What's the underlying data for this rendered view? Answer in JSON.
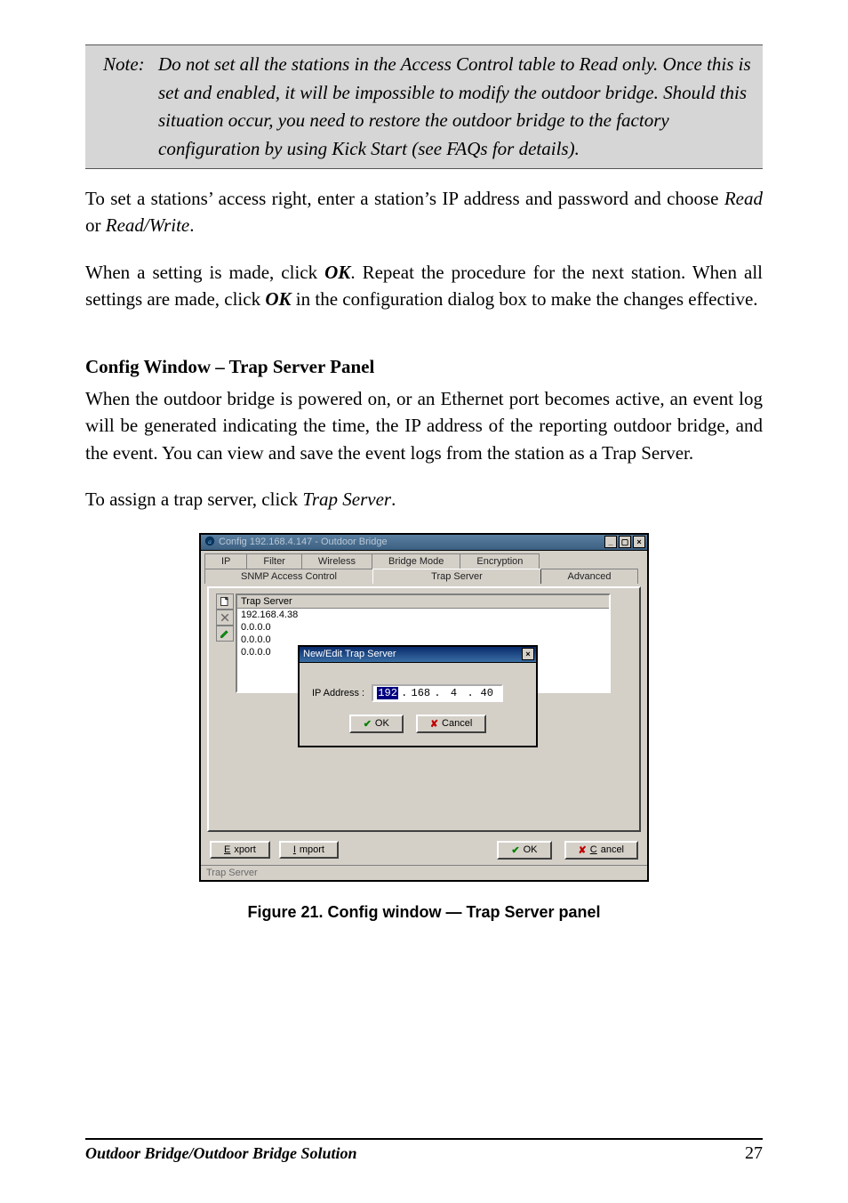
{
  "note": {
    "label": "Note:",
    "text": "Do not set all the stations in the Access Control table to Read only. Once this is set and enabled, it will be impossible to modify the outdoor bridge. Should this situation occur, you need to restore the outdoor bridge to the factory configuration by using Kick Start (see FAQs for details)."
  },
  "para1_a": "To set a stations’ access right, enter a station’s IP address and password and choose ",
  "para1_b": "Read",
  "para1_c": " or ",
  "para1_d": "Read/Write",
  "para1_e": ".",
  "para2_a": "When a setting is made, click ",
  "para2_b": "OK",
  "para2_c": ". Repeat the procedure for the next station. When all settings are made, click ",
  "para2_d": "OK",
  "para2_e": " in the configuration dialog box to make the changes effective.",
  "heading": "Config Window – Trap Server Panel",
  "para3": "When the outdoor bridge is powered on, or an Ethernet port becomes active, an event log will be generated indicating the time, the IP address of the reporting outdoor bridge, and the event. You can view and save the event logs from the station as a Trap Server.",
  "para4_a": "To assign a trap server, click ",
  "para4_b": "Trap Server",
  "para4_c": ".",
  "figcap": "Figure 21.  Config window — Trap Server panel",
  "footer": {
    "title": "Outdoor Bridge/Outdoor Bridge Solution",
    "page": "27"
  },
  "win": {
    "title": "Config 192.168.4.147 - Outdoor Bridge",
    "tabs_row1": [
      "IP",
      "Filter",
      "Wireless",
      "Bridge Mode",
      "Encryption"
    ],
    "tabs_row2": [
      "SNMP Access Control",
      "Trap Server",
      "Advanced"
    ],
    "active_tab": "Trap Server",
    "list_header": "Trap Server",
    "list_items": [
      "192.168.4.38",
      "0.0.0.0",
      "0.0.0.0",
      "0.0.0.0"
    ],
    "buttons": {
      "export": "Export",
      "import": "Import",
      "ok": "OK",
      "cancel": "Cancel"
    },
    "status": "Trap Server"
  },
  "dlg": {
    "title": "New/Edit Trap Server",
    "ip_label": "IP Address :",
    "ip": [
      "192",
      "168",
      "4",
      "40"
    ],
    "ok": "OK",
    "cancel": "Cancel"
  },
  "glyph": {
    "check": "✔",
    "cross": "✘",
    "underline": "_",
    "times": "×",
    "box": "▢",
    "dash": "–"
  },
  "chart_data": null
}
